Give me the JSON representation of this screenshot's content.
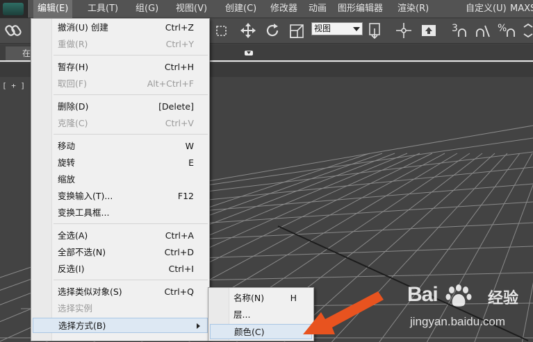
{
  "menubar": {
    "items": [
      "编辑(E)",
      "工具(T)",
      "组(G)",
      "视图(V)",
      "创建(C)",
      "修改器",
      "动画",
      "图形编辑器",
      "渲染(R)",
      "自定义(U)",
      "MAXS"
    ]
  },
  "toolbar": {
    "view_select": "视图",
    "snap_label": "3",
    "percent_label": "%"
  },
  "ribbon": {
    "tab_label": "在"
  },
  "viewport": {
    "label": "[ + ] ["
  },
  "edit_menu": {
    "items": [
      {
        "label": "撤消(U) 创建",
        "shortcut": "Ctrl+Z",
        "disabled": false
      },
      {
        "label": "重做(R)",
        "shortcut": "Ctrl+Y",
        "disabled": true
      },
      {
        "label": "暂存(H)",
        "shortcut": "Ctrl+H",
        "disabled": false
      },
      {
        "label": "取回(F)",
        "shortcut": "Alt+Ctrl+F",
        "disabled": true
      },
      {
        "label": "删除(D)",
        "shortcut": "[Delete]",
        "disabled": false
      },
      {
        "label": "克隆(C)",
        "shortcut": "Ctrl+V",
        "disabled": true
      },
      {
        "label": "移动",
        "shortcut": "W",
        "disabled": false
      },
      {
        "label": "旋转",
        "shortcut": "E",
        "disabled": false
      },
      {
        "label": "缩放",
        "shortcut": "",
        "disabled": false
      },
      {
        "label": "变换输入(T)...",
        "shortcut": "F12",
        "disabled": false
      },
      {
        "label": "变换工具框...",
        "shortcut": "",
        "disabled": false
      },
      {
        "label": "全选(A)",
        "shortcut": "Ctrl+A",
        "disabled": false
      },
      {
        "label": "全部不选(N)",
        "shortcut": "Ctrl+D",
        "disabled": false
      },
      {
        "label": "反选(I)",
        "shortcut": "Ctrl+I",
        "disabled": false
      },
      {
        "label": "选择类似对象(S)",
        "shortcut": "Ctrl+Q",
        "disabled": false
      },
      {
        "label": "选择实例",
        "shortcut": "",
        "disabled": true
      },
      {
        "label": "选择方式(B)",
        "shortcut": "",
        "disabled": false
      }
    ]
  },
  "select_by_submenu": {
    "items": [
      {
        "label": "名称(N)",
        "shortcut": "H"
      },
      {
        "label": "层...",
        "shortcut": ""
      },
      {
        "label": "颜色(C)",
        "shortcut": ""
      }
    ]
  },
  "watermark": {
    "brand": "Bai",
    "brand_suffix": "经验",
    "url": "jingyan.baidu.com"
  },
  "colors": {
    "annotation_arrow": "#e8531f",
    "menu_highlight": "#dde8f3"
  }
}
